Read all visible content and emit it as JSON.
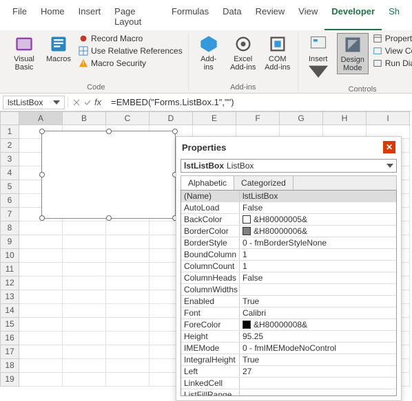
{
  "tabs": [
    "File",
    "Home",
    "Insert",
    "Page Layout",
    "Formulas",
    "Data",
    "Review",
    "View",
    "Developer",
    "Sh"
  ],
  "ribbon": {
    "code": {
      "visual_basic": "Visual\nBasic",
      "macros": "Macros",
      "record": "Record Macro",
      "relative": "Use Relative References",
      "security": "Macro Security",
      "label": "Code"
    },
    "addins": {
      "addins": "Add-\nins",
      "excel": "Excel\nAdd-ins",
      "com": "COM\nAdd-ins",
      "label": "Add-ins"
    },
    "controls": {
      "insert": "Insert",
      "design": "Design\nMode",
      "properties": "Propertie",
      "viewcode": "View Coc",
      "rundialog": "Run Dialo",
      "label": "Controls"
    }
  },
  "name_box": "lstListBox",
  "formula": "=EMBED(\"Forms.ListBox.1\",\"\")",
  "cols": [
    "A",
    "B",
    "C",
    "D",
    "E",
    "F",
    "G",
    "H",
    "I"
  ],
  "rows": [
    1,
    2,
    3,
    4,
    5,
    6,
    7,
    8,
    9,
    10,
    11,
    12,
    13,
    14,
    15,
    16,
    17,
    18,
    19
  ],
  "props": {
    "title": "Properties",
    "obj_name": "lstListBox",
    "obj_type": "ListBox",
    "tabs": [
      "Alphabetic",
      "Categorized"
    ],
    "items": [
      {
        "k": "(Name)",
        "v": "lstListBox",
        "sel": true
      },
      {
        "k": "AutoLoad",
        "v": "False"
      },
      {
        "k": "BackColor",
        "v": "&H80000005&",
        "swatch": "#ffffff"
      },
      {
        "k": "BorderColor",
        "v": "&H80000006&",
        "swatch": "#808080"
      },
      {
        "k": "BorderStyle",
        "v": "0 - fmBorderStyleNone"
      },
      {
        "k": "BoundColumn",
        "v": "1"
      },
      {
        "k": "ColumnCount",
        "v": "1"
      },
      {
        "k": "ColumnHeads",
        "v": "False"
      },
      {
        "k": "ColumnWidths",
        "v": ""
      },
      {
        "k": "Enabled",
        "v": "True"
      },
      {
        "k": "Font",
        "v": "Calibri"
      },
      {
        "k": "ForeColor",
        "v": "&H80000008&",
        "swatch": "#000000"
      },
      {
        "k": "Height",
        "v": "95.25"
      },
      {
        "k": "IMEMode",
        "v": "0 - fmIMEModeNoControl"
      },
      {
        "k": "IntegralHeight",
        "v": "True"
      },
      {
        "k": "Left",
        "v": "27"
      },
      {
        "k": "LinkedCell",
        "v": ""
      },
      {
        "k": "ListFillRange",
        "v": ""
      }
    ]
  }
}
